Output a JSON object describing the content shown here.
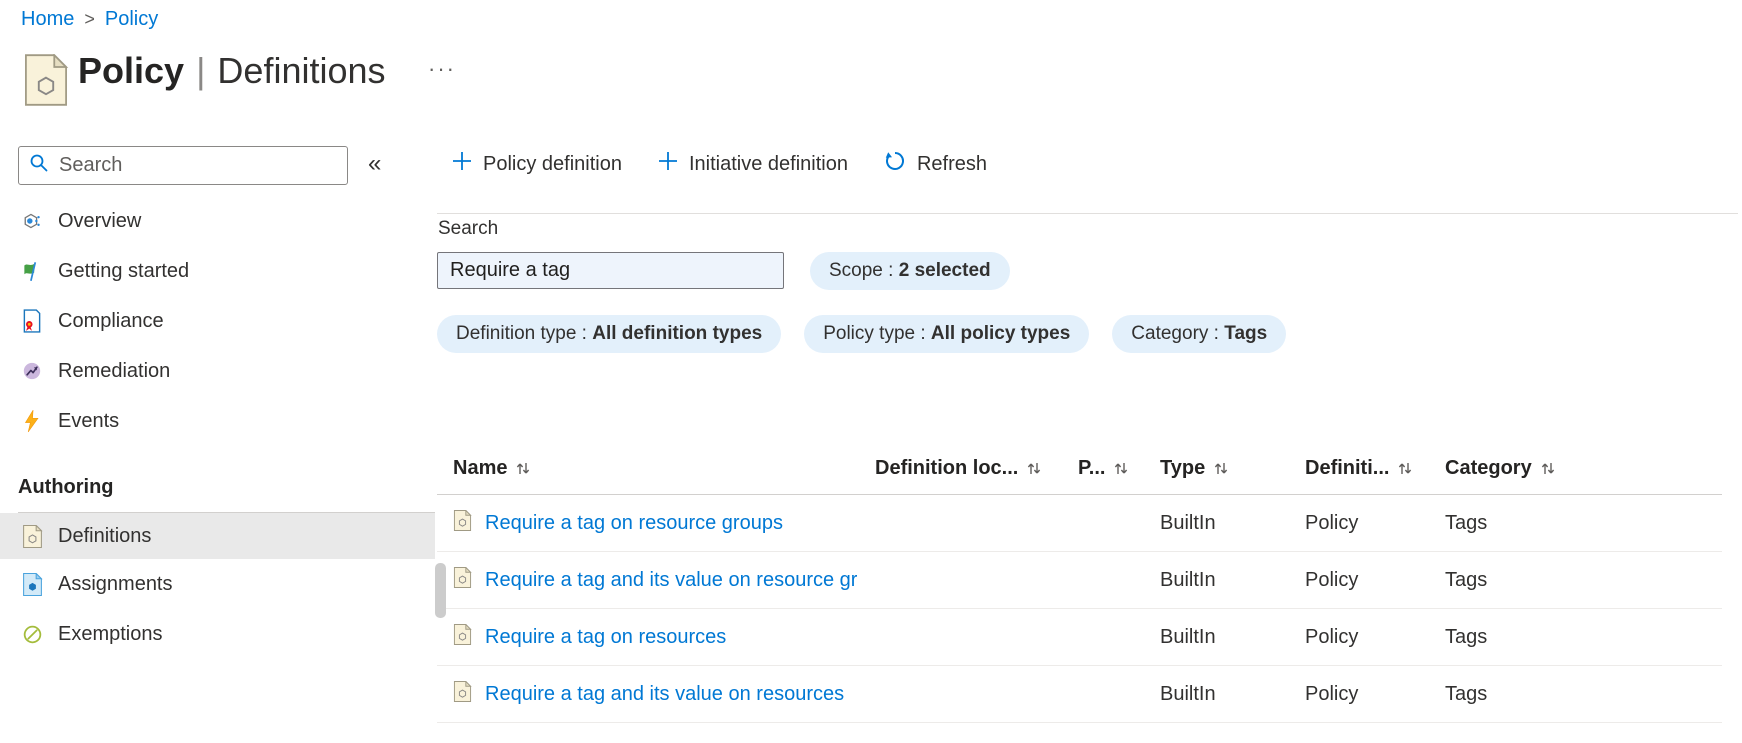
{
  "breadcrumb": {
    "separator": ">",
    "items": [
      {
        "label": "Home"
      },
      {
        "label": "Policy"
      }
    ]
  },
  "header": {
    "title_primary": "Policy",
    "title_separator": "|",
    "title_secondary": "Definitions",
    "more_glyph": "···"
  },
  "sidebar": {
    "search_placeholder": "Search",
    "collapse_glyph": "«",
    "items": [
      {
        "label": "Overview",
        "icon": "overview-icon"
      },
      {
        "label": "Getting started",
        "icon": "getting-started-icon"
      },
      {
        "label": "Compliance",
        "icon": "compliance-icon"
      },
      {
        "label": "Remediation",
        "icon": "remediation-icon"
      },
      {
        "label": "Events",
        "icon": "events-icon"
      }
    ],
    "section": {
      "label": "Authoring",
      "items": [
        {
          "label": "Definitions",
          "icon": "definitions-icon",
          "selected": true
        },
        {
          "label": "Assignments",
          "icon": "assignments-icon",
          "selected": false
        },
        {
          "label": "Exemptions",
          "icon": "exemptions-icon",
          "selected": false
        }
      ]
    }
  },
  "toolbar": {
    "buttons": [
      {
        "label": "Policy definition",
        "icon": "plus-icon"
      },
      {
        "label": "Initiative definition",
        "icon": "plus-icon"
      },
      {
        "label": "Refresh",
        "icon": "refresh-icon"
      }
    ]
  },
  "filters": {
    "search_label": "Search",
    "search_value": "Require a tag",
    "pill_separator": " : ",
    "pills": [
      {
        "label": "Scope",
        "value": "2 selected"
      },
      {
        "label": "Definition type",
        "value": "All definition types"
      },
      {
        "label": "Policy type",
        "value": "All policy types"
      },
      {
        "label": "Category",
        "value": "Tags"
      }
    ]
  },
  "table": {
    "columns": [
      {
        "label": "Name"
      },
      {
        "label": "Definition loc..."
      },
      {
        "label": "P..."
      },
      {
        "label": "Type"
      },
      {
        "label": "Definiti..."
      },
      {
        "label": "Category"
      }
    ],
    "rows": [
      {
        "name": "Require a tag on resource groups",
        "definition_location": "",
        "p": "",
        "type": "BuiltIn",
        "definition_type": "Policy",
        "category": "Tags"
      },
      {
        "name": "Require a tag and its value on resource gr",
        "definition_location": "",
        "p": "",
        "type": "BuiltIn",
        "definition_type": "Policy",
        "category": "Tags"
      },
      {
        "name": "Require a tag on resources",
        "definition_location": "",
        "p": "",
        "type": "BuiltIn",
        "definition_type": "Policy",
        "category": "Tags"
      },
      {
        "name": "Require a tag and its value on resources",
        "definition_location": "",
        "p": "",
        "type": "BuiltIn",
        "definition_type": "Policy",
        "category": "Tags"
      }
    ]
  },
  "colors": {
    "link": "#0078d4",
    "pill_background": "#e3f0fb",
    "selected_item_background": "#e9e9e9",
    "policy_icon_fill": "#f9f2da"
  }
}
